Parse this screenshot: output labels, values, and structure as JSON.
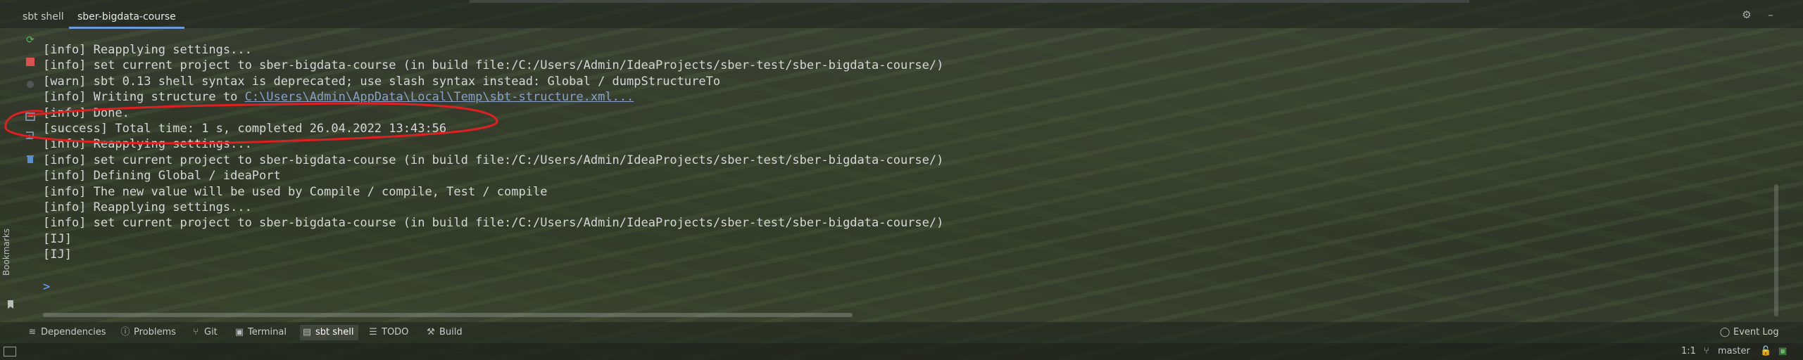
{
  "tabs": [
    {
      "label": "sbt shell",
      "active": false
    },
    {
      "label": "sber-bigdata-course",
      "active": true
    }
  ],
  "top_right": {
    "settings_icon": "gear-icon",
    "minimize_icon": "minimize-icon"
  },
  "gutter": {
    "icons": [
      "refresh-icon",
      "stop-icon",
      "record-icon",
      "screenshot-icon",
      "wrap-icon",
      "trash-icon"
    ],
    "bookmarks_label": "Bookmarks"
  },
  "console": {
    "lines": [
      {
        "text": "[info] Reapplying settings..."
      },
      {
        "text": "[info] set current project to sber-bigdata-course (in build file:/C:/Users/Admin/IdeaProjects/sber-test/sber-bigdata-course/)"
      },
      {
        "text": "[warn] sbt 0.13 shell syntax is deprecated; use slash syntax instead: Global / dumpStructureTo"
      },
      {
        "text": "[info] Writing structure to ",
        "link": "C:\\Users\\Admin\\AppData\\Local\\Temp\\sbt-structure.xml..."
      },
      {
        "text": "[info] Done."
      },
      {
        "text": "[success] Total time: 1 s, completed 26.04.2022 13:43:56"
      },
      {
        "text": "[info] Reapplying settings..."
      },
      {
        "text": "[info] set current project to sber-bigdata-course (in build file:/C:/Users/Admin/IdeaProjects/sber-test/sber-bigdata-course/)"
      },
      {
        "text": "[info] Defining Global / ideaPort"
      },
      {
        "text": "[info] The new value will be used by Compile / compile, Test / compile"
      },
      {
        "text": "[info] Reapplying settings..."
      },
      {
        "text": "[info] set current project to sber-bigdata-course (in build file:/C:/Users/Admin/IdeaProjects/sber-test/sber-bigdata-course/)"
      },
      {
        "text": "[IJ]"
      },
      {
        "text": "[IJ]"
      }
    ],
    "prompt": ">"
  },
  "annotation": {
    "color": "#e02020",
    "shape": "hand-drawn ellipse"
  },
  "tool_windows": [
    {
      "label": "Dependencies",
      "icon": "layers-icon",
      "active": false
    },
    {
      "label": "Problems",
      "icon": "info-icon",
      "active": false
    },
    {
      "label": "Git",
      "icon": "git-icon",
      "active": false
    },
    {
      "label": "Terminal",
      "icon": "terminal-icon",
      "active": false
    },
    {
      "label": "sbt shell",
      "icon": "sbt-shell-icon",
      "active": true
    },
    {
      "label": "TODO",
      "icon": "todo-icon",
      "active": false
    },
    {
      "label": "Build",
      "icon": "hammer-icon",
      "active": false
    }
  ],
  "event_log": {
    "label": "Event Log",
    "icon": "bubble-icon"
  },
  "status_bar": {
    "position": "1:1",
    "branch": "master",
    "branch_icon": "branch-icon",
    "lock_icon": "lock-icon",
    "status_icon": "status-icon"
  },
  "colors": {
    "accent": "#6a9bd8",
    "annotation": "#e02020",
    "prompt": "#6ea7ff",
    "link": "#8aa0c8"
  }
}
